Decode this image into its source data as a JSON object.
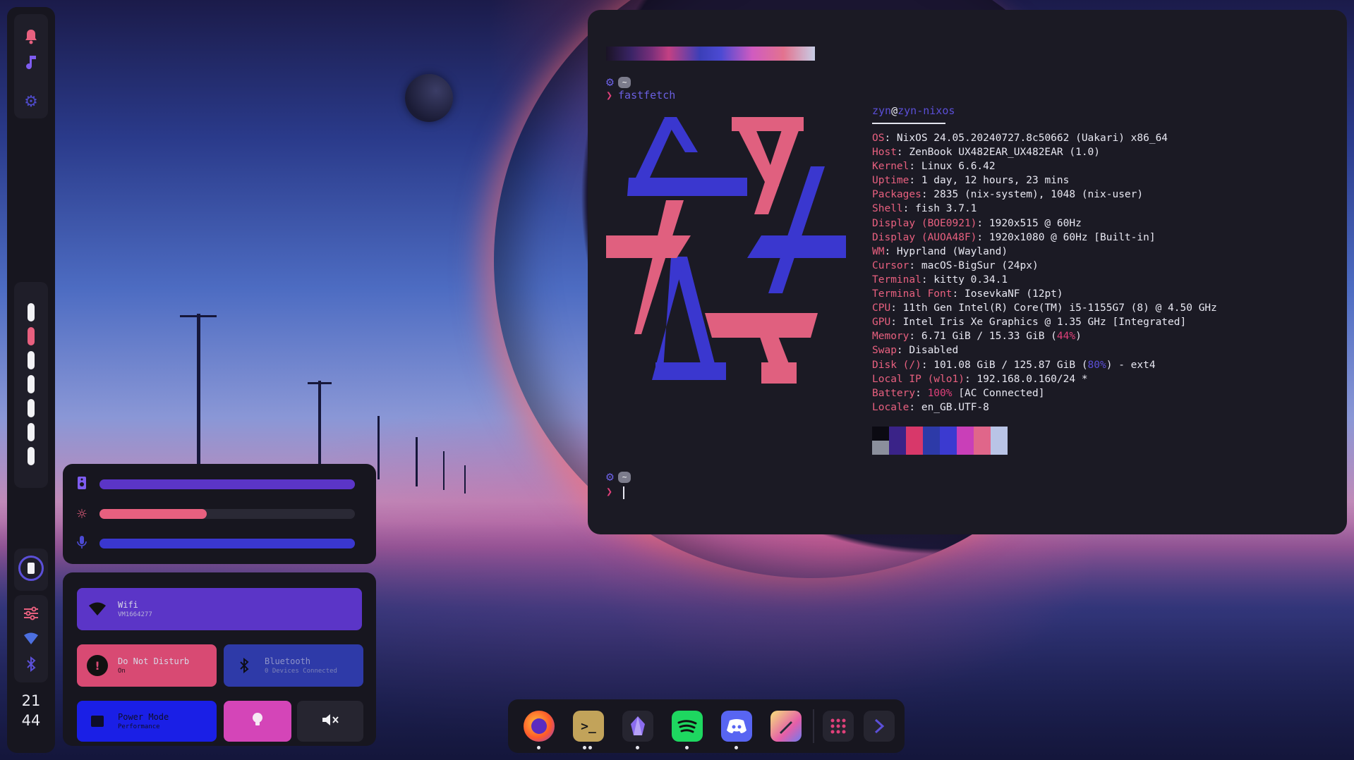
{
  "left_bar": {
    "icons": [
      "bell-icon",
      "music-note-icon",
      "gear-icon"
    ],
    "workspaces": [
      {
        "active": false
      },
      {
        "active": true
      },
      {
        "active": false
      },
      {
        "active": false
      },
      {
        "active": false
      },
      {
        "active": false
      },
      {
        "active": false
      }
    ],
    "bottom_icons": [
      "battery-icon",
      "sliders-icon",
      "wifi-icon",
      "bluetooth-icon"
    ],
    "clock_hour": "21",
    "clock_minute": "44"
  },
  "sliders": {
    "volume": {
      "icon": "speaker-icon",
      "level": 1.0,
      "color": "#5b35c7"
    },
    "brightness": {
      "icon": "sun-icon",
      "level": 0.42,
      "color": "#e8607f"
    },
    "microphone": {
      "icon": "microphone-icon",
      "level": 1.0,
      "color": "#3a37cf"
    }
  },
  "quick_settings": {
    "wifi": {
      "title": "Wifi",
      "subtitle": "VM1664277",
      "color": "#5b35c7"
    },
    "dnd": {
      "title": "Do Not Disturb",
      "subtitle": "On",
      "color": "#d84a73"
    },
    "bluetooth": {
      "title": "Bluetooth",
      "subtitle": "0 Devices Connected",
      "color": "#2e3aa8"
    },
    "power": {
      "title": "Power Mode",
      "subtitle": "Performance",
      "color": "#1a1fe6"
    },
    "light": {
      "icon": "lightbulb-icon",
      "color": "#d445b8"
    },
    "mute": {
      "icon": "muted-speaker-icon",
      "color": "#262530"
    }
  },
  "terminal": {
    "tilde": "~",
    "command": "fastfetch",
    "chevron": "❯",
    "user": "zyn",
    "at": "@",
    "host": "zyn-nixos",
    "info": [
      {
        "key": "OS",
        "value": ": NixOS 24.05.20240727.8c50662 (Uakari) x86_64"
      },
      {
        "key": "Host",
        "value": ": ZenBook UX482EAR_UX482EAR (1.0)"
      },
      {
        "key": "Kernel",
        "value": ": Linux 6.6.42"
      },
      {
        "key": "Uptime",
        "value": ": 1 day, 12 hours, 23 mins"
      },
      {
        "key": "Packages",
        "value": ": 2835 (nix-system), 1048 (nix-user)"
      },
      {
        "key": "Shell",
        "value": ": fish 3.7.1"
      },
      {
        "key": "Display (BOE0921)",
        "value": ": 1920x515 @ 60Hz"
      },
      {
        "key": "Display (AUOA48F)",
        "value": ": 1920x1080 @ 60Hz [Built-in]"
      },
      {
        "key": "WM",
        "value": ": Hyprland (Wayland)"
      },
      {
        "key": "Cursor",
        "value": ": macOS-BigSur (24px)"
      },
      {
        "key": "Terminal",
        "value": ": kitty 0.34.1"
      },
      {
        "key": "Terminal Font",
        "value": ": IosevkaNF (12pt)"
      },
      {
        "key": "CPU",
        "value": ": 11th Gen Intel(R) Core(TM) i5-1155G7 (8) @ 4.50 GHz"
      },
      {
        "key": "GPU",
        "value": ": Intel Iris Xe Graphics @ 1.35 GHz [Integrated]"
      },
      {
        "key": "Memory",
        "value_pre": ": 6.71 GiB / 15.33 GiB (",
        "pct": "44%",
        "value_post": ")",
        "pct_color": "pink"
      },
      {
        "key": "Swap",
        "value": ": Disabled"
      },
      {
        "key": "Disk (/)",
        "value_pre": ": 101.08 GiB / 125.87 GiB (",
        "pct": "80%",
        "value_post": ") - ext4",
        "pct_color": "purple"
      },
      {
        "key": "Local IP (wlo1)",
        "value": ": 192.168.0.160/24 *"
      },
      {
        "key": "Battery",
        "value_pre": ": ",
        "pct": "100%",
        "value_post": " [AC Connected]",
        "pct_color": "pink"
      },
      {
        "key": "Locale",
        "value": ": en_GB.UTF-8"
      }
    ],
    "palette_top": [
      "#0b0a12",
      "#3a2388",
      "#d8386a",
      "#2d3aa8",
      "#3b3ad0",
      "#c93fb8",
      "#e0668a",
      "#b9c4e6"
    ],
    "palette_bottom": [
      "#8b8f9c",
      "#3a2388",
      "#d8386a",
      "#2d3aa8",
      "#3b3ad0",
      "#c93fb8",
      "#e0668a",
      "#b9c4e6"
    ],
    "logo_colors": {
      "blue": "#3a37cf",
      "pink": "#e0607f"
    }
  },
  "dock": {
    "apps": [
      {
        "name": "firefox",
        "icon": "firefox-icon",
        "running": 1
      },
      {
        "name": "terminal",
        "icon": "terminal-icon",
        "running": 2
      },
      {
        "name": "obsidian",
        "icon": "obsidian-icon",
        "running": 1
      },
      {
        "name": "spotify",
        "icon": "spotify-icon",
        "running": 1
      },
      {
        "name": "discord",
        "icon": "discord-icon",
        "running": 1
      },
      {
        "name": "color-picker",
        "icon": "color-picker-icon",
        "running": 0
      }
    ],
    "launcher_icon": "app-grid-icon",
    "next_icon": "chevron-right-icon"
  }
}
